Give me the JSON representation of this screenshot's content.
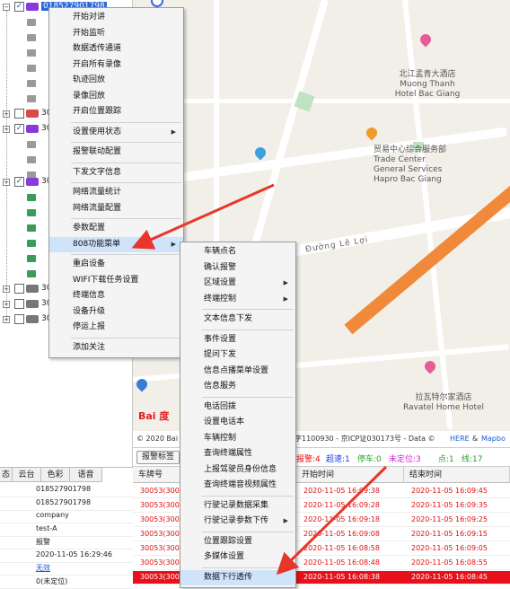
{
  "tree": {
    "first_label": "018527901798",
    "rows": [
      {
        "label": "30"
      },
      {
        "label": "30"
      },
      {
        "label": "30"
      },
      {
        "label": "30"
      },
      {
        "label": "30"
      },
      {
        "label": "30"
      },
      {
        "label": "30"
      },
      {
        "label": "GE"
      }
    ]
  },
  "map": {
    "poi_hotel": [
      "北江孟青大酒店",
      "Muong Thanh",
      "Hotel Bac Giang"
    ],
    "poi_trade": [
      "贸易中心综合服务部",
      "Trade Center",
      "General Services",
      "Hapro Bac Giang"
    ],
    "poi_ravatel": [
      "拉瓦特尔家酒店",
      "Ravatel Home Hotel"
    ],
    "road_name": "Đường Lê Lợi",
    "logo": "Bai 度",
    "copyright": "© 2020 Bai",
    "copyright_right": "字1100930 - 京ICP证030173号 - Data ©",
    "copyright_here": "HERE",
    "copyright_amp": "&",
    "copyright_mapbox": "Mapbo"
  },
  "status": {
    "tag_button": "报警标签",
    "items": [
      {
        "text": "报警:4",
        "color": "#e01010"
      },
      {
        "text": "超速:1",
        "color": "#1a3fd8"
      },
      {
        "text": "停车:0",
        "color": "#2aa02a"
      },
      {
        "text": "未定位:3",
        "color": "#d020d0"
      },
      {
        "text": "点:1",
        "color": "#2aa02a"
      },
      {
        "text": "线:17",
        "color": "#2aa02a"
      }
    ]
  },
  "left_table": {
    "headers": [
      "态",
      "云台",
      "色彩",
      "语音"
    ],
    "values": [
      "018527901798",
      "018527901798",
      "company",
      "test-A",
      "报警",
      "2020-11-05 16:29:46",
      "无效",
      "0(未定位)"
    ]
  },
  "grid": {
    "headers": [
      "车牌号",
      "开始时间",
      "结束时间"
    ],
    "rows": [
      {
        "plate": "30053(300",
        "start": "2020-11-05 16:09:38",
        "end": "2020-11-05 16:09:45"
      },
      {
        "plate": "30053(300",
        "start": "2020-11-05 16:09:28",
        "end": "2020-11-05 16:09:35"
      },
      {
        "plate": "30053(300",
        "start": "2020-11-05 16:09:18",
        "end": "2020-11-05 16:09:25"
      },
      {
        "plate": "30053(300",
        "start": "2020-11-05 16:09:08",
        "end": "2020-11-05 16:09:15"
      },
      {
        "plate": "30053(300",
        "start": "2020-11-05 16:08:58",
        "end": "2020-11-05 16:09:05"
      },
      {
        "plate": "30053(300",
        "start": "2020-11-05 16:08:48",
        "end": "2020-11-05 16:08:55"
      },
      {
        "plate": "30053(300",
        "start": "2020-11-05 16:08:38",
        "end": "2020-11-05 16:08:45"
      }
    ]
  },
  "menu1": {
    "items": [
      {
        "label": "开始对讲"
      },
      {
        "label": "开始监听"
      },
      {
        "label": "数据透传通道"
      },
      {
        "label": "开启所有录像"
      },
      {
        "label": "轨迹回放"
      },
      {
        "label": "录像回放"
      },
      {
        "label": "开启位置跟踪"
      },
      {
        "sep": true
      },
      {
        "label": "设置使用状态",
        "sub": true
      },
      {
        "sep": true
      },
      {
        "label": "报警联动配置"
      },
      {
        "sep": true
      },
      {
        "label": "下发文字信息"
      },
      {
        "sep": true
      },
      {
        "label": "网络流量统计"
      },
      {
        "label": "网络流量配置"
      },
      {
        "sep": true
      },
      {
        "label": "参数配置"
      },
      {
        "label": "808功能菜单",
        "sub": true,
        "hl": true
      },
      {
        "sep": true
      },
      {
        "label": "重启设备"
      },
      {
        "label": "WIFI下载任务设置"
      },
      {
        "label": "终端信息"
      },
      {
        "label": "设备升级"
      },
      {
        "label": "停运上报"
      },
      {
        "sep": true
      },
      {
        "label": "添加关注"
      }
    ]
  },
  "menu2": {
    "items": [
      {
        "label": "车辆点名"
      },
      {
        "label": "确认报警"
      },
      {
        "label": "区域设置",
        "sub": true
      },
      {
        "label": "终端控制",
        "sub": true
      },
      {
        "sep": true
      },
      {
        "label": "文本信息下发"
      },
      {
        "sep": true
      },
      {
        "label": "事件设置"
      },
      {
        "label": "提问下发"
      },
      {
        "label": "信息点播菜单设置"
      },
      {
        "label": "信息服务"
      },
      {
        "sep": true
      },
      {
        "label": "电话回拨"
      },
      {
        "label": "设置电话本"
      },
      {
        "label": "车辆控制"
      },
      {
        "label": "查询终端属性"
      },
      {
        "label": "上报驾驶员身份信息"
      },
      {
        "label": "查询终端音视频属性"
      },
      {
        "sep": true
      },
      {
        "label": "行驶记录数据采集"
      },
      {
        "label": "行驶记录参数下传",
        "sub": true
      },
      {
        "sep": true
      },
      {
        "label": "位置跟踪设置"
      },
      {
        "label": "多媒体设置",
        "sub": true
      },
      {
        "sep": true
      },
      {
        "label": "数据下行透传",
        "hl": true
      }
    ]
  }
}
